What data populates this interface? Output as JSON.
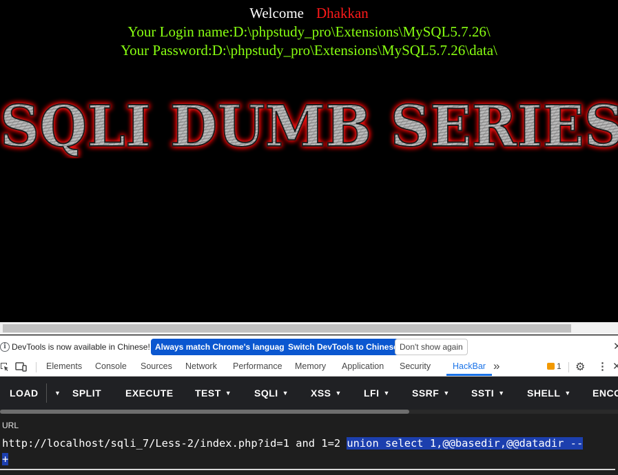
{
  "page": {
    "welcome_label": "Welcome",
    "username": "Dhakkan",
    "login_line": "Your Login name:D:\\phpstudy_pro\\Extensions\\MySQL5.7.26\\",
    "password_line": "Your Password:D:\\phpstudy_pro\\Extensions\\MySQL5.7.26\\data\\",
    "banner_text": "SQLI DUMB SERIES"
  },
  "devtools_infobar": {
    "message": "DevTools is now available in Chinese!",
    "match_button": "Always match Chrome's language",
    "switch_button": "Switch DevTools to Chinese",
    "dismiss_button": "Don't show again",
    "close_glyph": "✕"
  },
  "devtools_tabs": {
    "items": [
      "Elements",
      "Console",
      "Sources",
      "Network",
      "Performance",
      "Memory",
      "Application",
      "Security",
      "HackBar"
    ],
    "active": "HackBar",
    "more_glyph": "»",
    "issues_count": "1",
    "icons": [
      "inspect-icon",
      "device-toolbar-icon",
      "issues-icon",
      "gear-icon",
      "kebab-menu-icon",
      "close-icon"
    ]
  },
  "hackbar": {
    "buttons": [
      {
        "label": "LOAD",
        "dropdown": false
      },
      {
        "label": "SPLIT",
        "dropdown": false
      },
      {
        "label": "EXECUTE",
        "dropdown": false
      },
      {
        "label": "TEST",
        "dropdown": true
      },
      {
        "label": "SQLI",
        "dropdown": true
      },
      {
        "label": "XSS",
        "dropdown": true
      },
      {
        "label": "LFI",
        "dropdown": true
      },
      {
        "label": "SSRF",
        "dropdown": true
      },
      {
        "label": "SSTI",
        "dropdown": true
      },
      {
        "label": "SHELL",
        "dropdown": true
      },
      {
        "label": "ENCO",
        "dropdown": false
      }
    ],
    "url_label": "URL",
    "url_prefix": "http://localhost/sqli_7/Less-2/index.php?id=1 and 1=2 ",
    "url_selected_1": "union select 1,@@basedir,@@datadir --",
    "url_selected_2": "+",
    "colors": {
      "selection": "#1c3fae",
      "background": "#1e1e1e",
      "accent": "#1a73e8"
    }
  }
}
